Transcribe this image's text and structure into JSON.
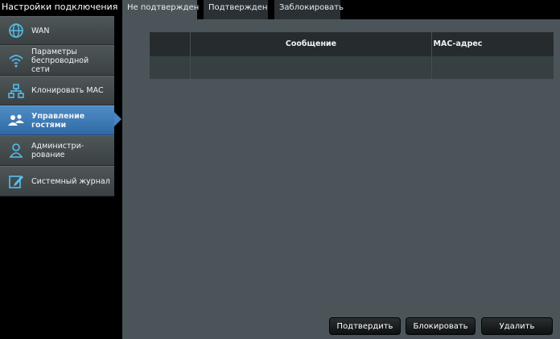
{
  "sidebar": {
    "title": "Настройки подключения",
    "items": [
      {
        "label": "WAN",
        "icon": "globe-icon"
      },
      {
        "label": "Параметры беспроводной сети",
        "icon": "wifi-icon"
      },
      {
        "label": "Клонировать MAC",
        "icon": "network-icon"
      },
      {
        "label": "Управление гостями",
        "icon": "guests-icon"
      },
      {
        "label": "Администри-рование",
        "icon": "admin-user-icon"
      },
      {
        "label": "Системный журнал",
        "icon": "edit-log-icon"
      }
    ],
    "active_index": 3
  },
  "tabs": [
    {
      "label": "Не подтвержден"
    },
    {
      "label": "Подтвержден"
    },
    {
      "label": "Заблокировать"
    }
  ],
  "table": {
    "columns": [
      "",
      "Сообщение",
      "MAC-адрес"
    ],
    "rows": [
      [
        "",
        "",
        ""
      ]
    ]
  },
  "buttons": {
    "confirm": "Подтвердить",
    "block": "Блокировать",
    "delete": "Удалить"
  },
  "colors": {
    "accent": "#3d7ab8",
    "panel": "#4b5559"
  }
}
